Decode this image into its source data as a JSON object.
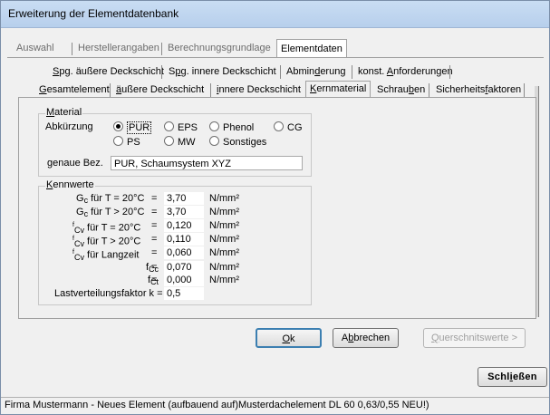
{
  "window": {
    "title": "Erweiterung der Elementdatenbank"
  },
  "top_tabs": [
    {
      "label": "Auswahl"
    },
    {
      "label": "Herstellerangaben"
    },
    {
      "label": "Berechnungsgrundlage"
    },
    {
      "label": "Elementdaten",
      "active": true
    }
  ],
  "sub_tabs_row1": [
    {
      "label": "Spg. äußere Deckschicht"
    },
    {
      "label": "Spg. innere Deckschicht"
    },
    {
      "label": "Abminderung"
    },
    {
      "label": "konst. Anforderungen"
    }
  ],
  "sub_tabs_row2": [
    {
      "label": "Gesamtelement"
    },
    {
      "label": "äußere Deckschicht"
    },
    {
      "label": "innere Deckschicht"
    },
    {
      "label": "Kernmaterial",
      "active": true
    },
    {
      "label": "Schrauben"
    },
    {
      "label": "Sicherheitsfaktoren"
    }
  ],
  "material": {
    "legend": "Material",
    "abbr_label": "Abkürzung",
    "options": [
      "PUR",
      "EPS",
      "Phenol",
      "CG",
      "PS",
      "MW",
      "Sonstiges"
    ],
    "selected": "PUR",
    "exact_label": "genaue Bez.",
    "exact_value": "PUR, Schaumsystem XYZ"
  },
  "kennwerte": {
    "legend": "Kennwerte",
    "rows": [
      {
        "sym": "G",
        "sub": "c",
        "sup": "",
        "cond": "für T = 20°C",
        "value": "3,70",
        "unit": "N/mm²"
      },
      {
        "sym": "G",
        "sub": "c",
        "sup": "",
        "cond": "für T > 20°C",
        "value": "3,70",
        "unit": "N/mm²"
      },
      {
        "sym": "",
        "sub": "Cv",
        "sup": "f",
        "cond": "für T = 20°C",
        "value": "0,120",
        "unit": "N/mm²"
      },
      {
        "sym": "",
        "sub": "Cv",
        "sup": "f",
        "cond": "für T > 20°C",
        "value": "0,110",
        "unit": "N/mm²"
      },
      {
        "sym": "",
        "sub": "Cv",
        "sup": "f",
        "cond": "für Langzeit",
        "value": "0,060",
        "unit": "N/mm²"
      },
      {
        "sym": "f",
        "sub": "Cc",
        "sup": "",
        "cond": "",
        "value": "0,070",
        "unit": "N/mm²"
      },
      {
        "sym": "f",
        "sub": "Ct",
        "sup": "",
        "cond": "",
        "value": "0,000",
        "unit": "N/mm²"
      }
    ],
    "last_label": "Lastverteilungsfaktor k =",
    "last_value": "0,5",
    "eq": "="
  },
  "buttons": {
    "ok": "Ok",
    "cancel": "Abbrechen",
    "cross_section": "Querschnitswerte >",
    "close": "Schließen"
  },
  "status": "Firma Mustermann - Neues Element  (aufbauend auf)Musterdachelement DL 60 0,63/0,55 NEU!)"
}
